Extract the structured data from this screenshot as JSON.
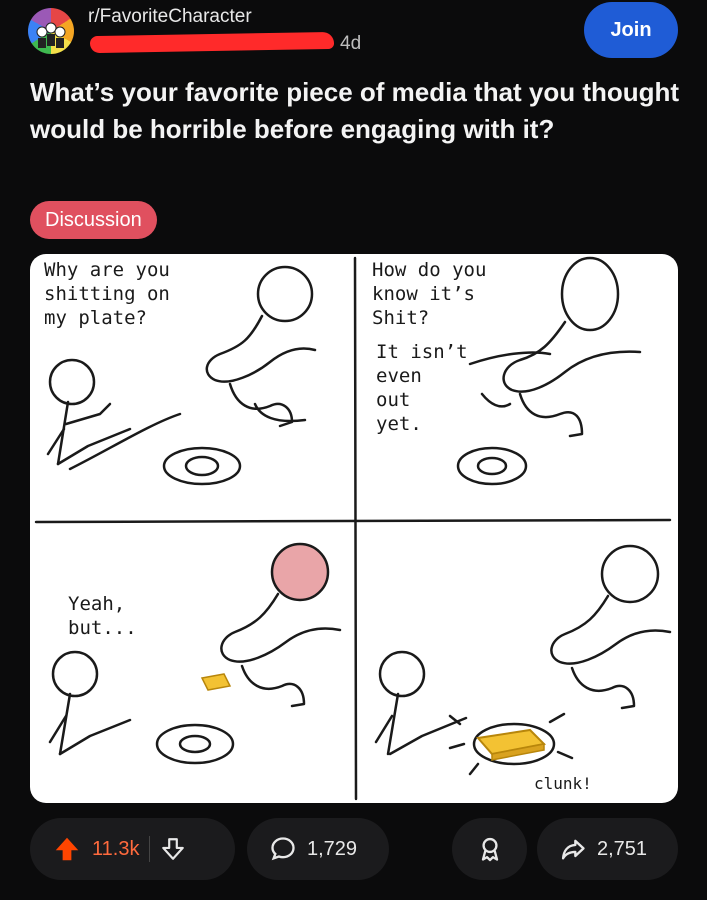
{
  "post": {
    "subreddit": "r/FavoriteCharacter",
    "time": "4d",
    "join_label": "Join",
    "title": "What’s your favorite piece of media that you thought would be horrible before engaging with it?",
    "flair": "Discussion"
  },
  "comic": {
    "panel1_text": "Why are you\nshitting on\nmy plate?",
    "panel2_text_a": "How do you\nknow it’s\nShit?",
    "panel2_text_b": "It isn’t\neven\nout\nyet.",
    "panel3_text": "Yeah,\nbut...",
    "panel4_text": "clunk!"
  },
  "actions": {
    "upvotes": "11.3k",
    "comments": "1,729",
    "shares": "2,751"
  },
  "colors": {
    "upvote_active": "#ff4500",
    "join_button": "#1f5cd6",
    "flair": "#e0505f",
    "gold_bar": "#f3c233"
  }
}
